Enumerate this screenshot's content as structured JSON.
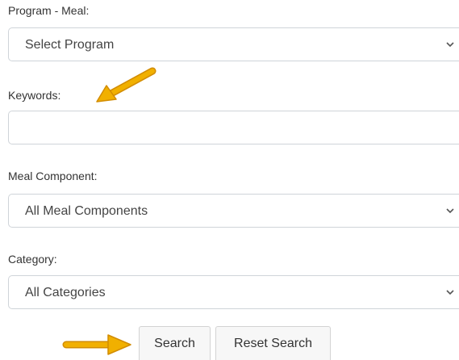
{
  "form": {
    "program": {
      "label": "Program - Meal:",
      "selected": "Select Program"
    },
    "keywords": {
      "label": "Keywords:",
      "value": ""
    },
    "meal_component": {
      "label": "Meal Component:",
      "selected": "All Meal Components"
    },
    "category": {
      "label": "Category:",
      "selected": "All Categories"
    },
    "buttons": {
      "search": "Search",
      "reset": "Reset Search"
    }
  },
  "annotations": {
    "arrow_color": "#f1b000",
    "arrow_outline_color": "#d28c00"
  },
  "icons": {
    "dropdown": "chevron-down-icon",
    "annotation": "arrow-icon"
  }
}
